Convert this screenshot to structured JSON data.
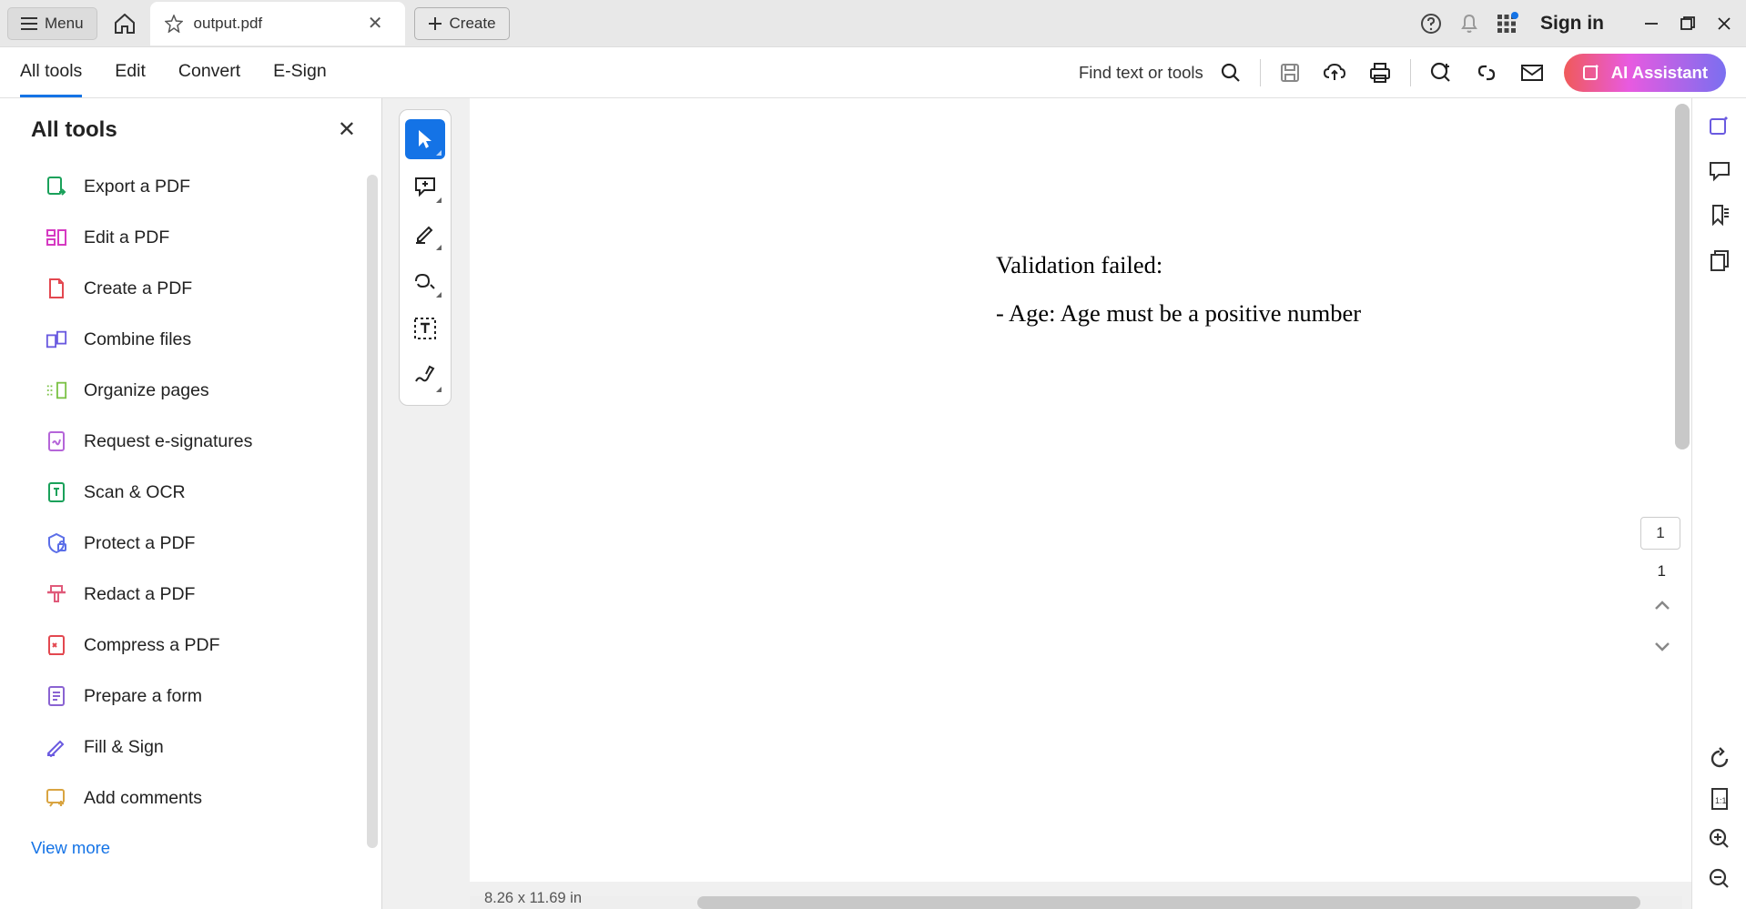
{
  "titlebar": {
    "menu_label": "Menu",
    "tab_title": "output.pdf",
    "create_label": "Create",
    "signin_label": "Sign in"
  },
  "menubar": {
    "items": [
      "All tools",
      "Edit",
      "Convert",
      "E-Sign"
    ],
    "active_index": 0,
    "find_label": "Find text or tools",
    "ai_label": "AI Assistant"
  },
  "sidebar": {
    "title": "All tools",
    "tools": [
      {
        "label": "Export a PDF",
        "color": "#1aa15a"
      },
      {
        "label": "Edit a PDF",
        "color": "#d63ac2"
      },
      {
        "label": "Create a PDF",
        "color": "#e34850"
      },
      {
        "label": "Combine files",
        "color": "#6a5ae0"
      },
      {
        "label": "Organize pages",
        "color": "#7cc247"
      },
      {
        "label": "Request e-signatures",
        "color": "#b565d9"
      },
      {
        "label": "Scan & OCR",
        "color": "#1aa15a"
      },
      {
        "label": "Protect a PDF",
        "color": "#5b6ee8"
      },
      {
        "label": "Redact a PDF",
        "color": "#e05a7a"
      },
      {
        "label": "Compress a PDF",
        "color": "#e34850"
      },
      {
        "label": "Prepare a form",
        "color": "#8a63d2"
      },
      {
        "label": "Fill & Sign",
        "color": "#6a5ae0"
      },
      {
        "label": "Add comments",
        "color": "#d9a441"
      }
    ],
    "view_more": "View more"
  },
  "document": {
    "line1": "Validation failed:",
    "line2": "- Age: Age must be a positive number",
    "page_dimensions": "8.26 x 11.69 in",
    "current_page": "1",
    "total_pages": "1"
  }
}
